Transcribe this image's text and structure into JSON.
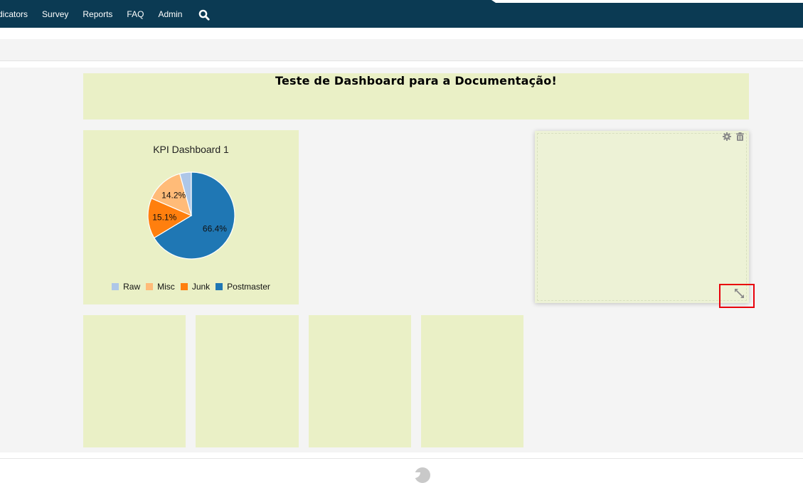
{
  "nav": {
    "items": [
      {
        "label": "dicators"
      },
      {
        "label": "Survey"
      },
      {
        "label": "Reports"
      },
      {
        "label": "FAQ"
      },
      {
        "label": "Admin"
      }
    ],
    "search_icon": "search-icon"
  },
  "dashboard": {
    "title": "Teste de Dashboard para a Documentação!",
    "kpi_widget": {
      "title": "KPI Dashboard 1"
    },
    "edit_widget": {
      "icons": [
        "gear-icon",
        "trash-icon",
        "resize-icon"
      ],
      "highlighted_control": "resize-icon"
    },
    "empty_widgets_count": 4
  },
  "colors": {
    "topbar": "#0b3a53",
    "widget_bg": "#eaf0c6",
    "highlight": "#e8000b"
  },
  "chart_data": {
    "type": "pie",
    "title": "KPI Dashboard 1",
    "legend_position": "bottom",
    "start_angle": "12 o'clock, clockwise",
    "series": [
      {
        "name": "Postmaster",
        "value": 66.4,
        "label": "66.4%",
        "color": "#1f77b4"
      },
      {
        "name": "Junk",
        "value": 15.1,
        "label": "15.1%",
        "color": "#ff7f0e"
      },
      {
        "name": "Misc",
        "value": 14.2,
        "label": "14.2%",
        "color": "#ffbb78"
      },
      {
        "name": "Raw",
        "value": 4.3,
        "label": "",
        "color": "#aec7e8"
      }
    ],
    "legend": [
      "Raw",
      "Misc",
      "Junk",
      "Postmaster"
    ]
  }
}
